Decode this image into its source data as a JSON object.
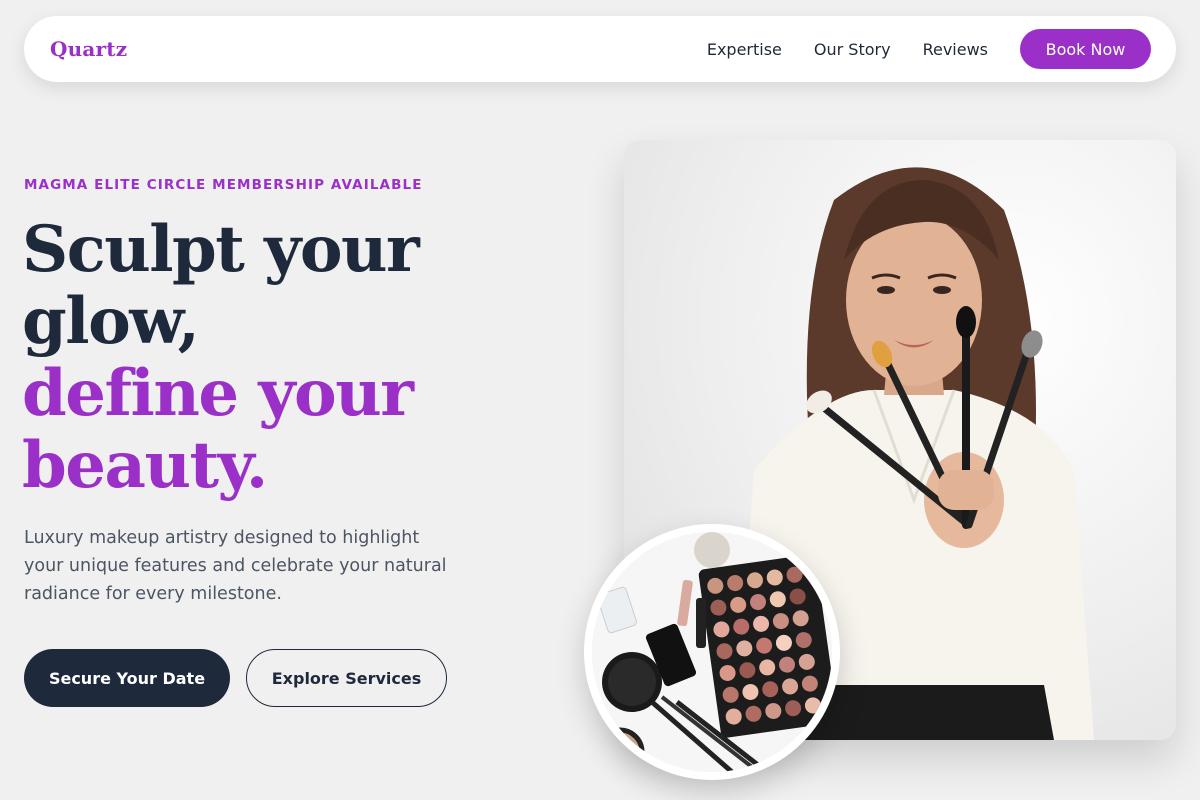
{
  "brand": {
    "name": "Quartz"
  },
  "nav": {
    "links": [
      "Expertise",
      "Our Story",
      "Reviews"
    ],
    "cta": "Book Now"
  },
  "hero": {
    "eyebrow": "MAGMA ELITE CIRCLE MEMBERSHIP AVAILABLE",
    "headline_line1": "Sculpt your",
    "headline_line2": "glow,",
    "headline_line3": "define your",
    "headline_line4": "beauty.",
    "description": "Luxury makeup artistry designed to highlight your unique features and celebrate your natural radiance for every milestone.",
    "primary_cta": "Secure Your Date",
    "secondary_cta": "Explore Services"
  },
  "colors": {
    "accent": "#9b30c9",
    "dark": "#1e293b",
    "background": "#f0f0f0"
  }
}
